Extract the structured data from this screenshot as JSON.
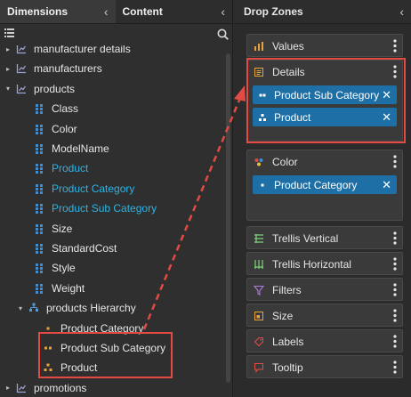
{
  "left_panel": {
    "tabs": [
      {
        "label": "Dimensions"
      },
      {
        "label": "Content"
      }
    ],
    "tree": [
      {
        "label": "manufacturer details",
        "kind": "dimension",
        "level": 0,
        "expander": "▸"
      },
      {
        "label": "manufacturers",
        "kind": "dimension",
        "level": 0,
        "expander": "▸"
      },
      {
        "label": "products",
        "kind": "dimension",
        "level": 0,
        "expander": "▾"
      },
      {
        "label": "Class",
        "kind": "attribute",
        "level": 1
      },
      {
        "label": "Color",
        "kind": "attribute",
        "level": 1
      },
      {
        "label": "ModelName",
        "kind": "attribute",
        "level": 1
      },
      {
        "label": "Product",
        "kind": "attribute",
        "level": 1,
        "highlighted": true
      },
      {
        "label": "Product Category",
        "kind": "attribute",
        "level": 1,
        "highlighted": true
      },
      {
        "label": "Product Sub Category",
        "kind": "attribute",
        "level": 1,
        "highlighted": true
      },
      {
        "label": "Size",
        "kind": "attribute",
        "level": 1
      },
      {
        "label": "StandardCost",
        "kind": "attribute",
        "level": 1
      },
      {
        "label": "Style",
        "kind": "attribute",
        "level": 1
      },
      {
        "label": "Weight",
        "kind": "attribute",
        "level": 1
      },
      {
        "label": "products Hierarchy",
        "kind": "hierarchy",
        "level": 1,
        "expander": "▾"
      },
      {
        "label": "Product Category",
        "kind": "level1",
        "level": 2
      },
      {
        "label": "Product Sub Category",
        "kind": "level2",
        "level": 2
      },
      {
        "label": "Product",
        "kind": "level3",
        "level": 2
      },
      {
        "label": "promotions",
        "kind": "dimension",
        "level": 0,
        "expander": "▸"
      }
    ]
  },
  "right_panel": {
    "title": "Drop Zones",
    "zones": [
      {
        "label": "Values",
        "icon": "bar-chart-icon",
        "chips": []
      },
      {
        "label": "Details",
        "icon": "details-icon",
        "chips": [
          {
            "label": "Product Sub Category",
            "icon": "level-two-icon"
          },
          {
            "label": "Product",
            "icon": "level-three-icon"
          }
        ]
      },
      {
        "label": "Color",
        "icon": "color-palette-icon",
        "chips": [
          {
            "label": "Product Category",
            "icon": "level-one-icon"
          }
        ]
      },
      {
        "label": "Trellis Vertical",
        "icon": "trellis-vertical-icon",
        "chips": []
      },
      {
        "label": "Trellis Horizontal",
        "icon": "trellis-horizontal-icon",
        "chips": []
      },
      {
        "label": "Filters",
        "icon": "filter-icon",
        "chips": []
      },
      {
        "label": "Size",
        "icon": "size-icon",
        "chips": []
      },
      {
        "label": "Labels",
        "icon": "tag-icon",
        "chips": []
      },
      {
        "label": "Tooltip",
        "icon": "tooltip-icon",
        "chips": []
      }
    ]
  },
  "colors": {
    "highlight": "#2bb4e6",
    "chip": "#1e6fa6",
    "annotation": "#e24a43",
    "attribute_icon": "#3d8fd1",
    "hierarchy_level": "#e8a23a"
  }
}
